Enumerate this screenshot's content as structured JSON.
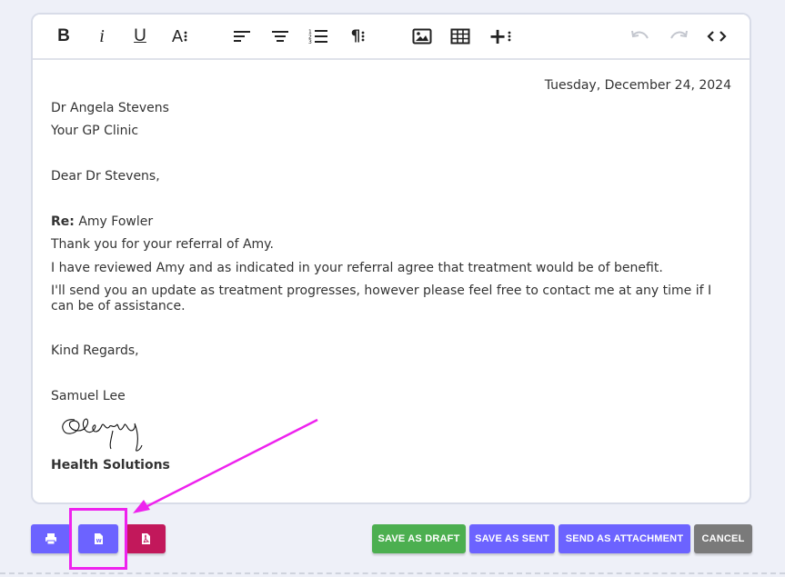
{
  "toolbar": {
    "buttons": [
      {
        "name": "bold",
        "icon": "bold-icon",
        "glyph": "B"
      },
      {
        "name": "italic",
        "icon": "italic-icon",
        "glyph": "i"
      },
      {
        "name": "underline",
        "icon": "underline-icon",
        "glyph": "U"
      },
      {
        "name": "font-size",
        "icon": "font-size-icon",
        "glyph": "A"
      },
      {
        "name": "align-left",
        "icon": "align-left-icon"
      },
      {
        "name": "align-center",
        "icon": "align-center-icon"
      },
      {
        "name": "ordered-list",
        "icon": "ordered-list-icon"
      },
      {
        "name": "paragraph",
        "icon": "paragraph-icon",
        "glyph": "¶"
      },
      {
        "name": "insert-image",
        "icon": "image-icon"
      },
      {
        "name": "insert-table",
        "icon": "table-icon"
      },
      {
        "name": "insert-more",
        "icon": "plus-icon",
        "glyph": "+"
      },
      {
        "name": "undo",
        "icon": "undo-icon"
      },
      {
        "name": "redo",
        "icon": "redo-icon"
      },
      {
        "name": "code-view",
        "icon": "code-icon"
      }
    ]
  },
  "letter": {
    "date": "Tuesday, December 24, 2024",
    "recipient_name": "Dr Angela Stevens",
    "recipient_org": "Your GP Clinic",
    "salutation": "Dear Dr Stevens,",
    "re_label": "Re:",
    "re_value": " Amy Fowler",
    "para1": "Thank you for your referral of Amy.",
    "para2": "I have reviewed Amy and as indicated in your referral agree that treatment would be of benefit.",
    "para3": "I'll send you an update as treatment progresses, however please feel free to contact me at any time if I can be of assistance.",
    "closing": "Kind Regards,",
    "signer": "Samuel Lee",
    "organization": "Health Solutions"
  },
  "actions": {
    "save_draft": "SAVE AS DRAFT",
    "save_sent": "SAVE AS SENT",
    "send_attachment": "SEND AS ATTACHMENT",
    "cancel": "CANCEL"
  },
  "colors": {
    "purple": "#6c63ff",
    "pdf": "#c2185b",
    "green": "#4caf50",
    "gray": "#7a7a7a",
    "highlight": "#ee22ee"
  }
}
